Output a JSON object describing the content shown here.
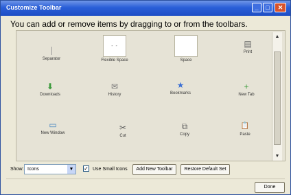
{
  "window": {
    "title": "Customize Toolbar",
    "heading": "You can add or remove items by dragging to or from the toolbars."
  },
  "palette": {
    "items": [
      {
        "label": "Separator",
        "icon": "separator-icon"
      },
      {
        "label": "Flexible Space",
        "icon": "flexible-space-icon",
        "glyph": "- -"
      },
      {
        "label": "Space",
        "icon": "space-icon"
      },
      {
        "label": "Print",
        "icon": "print-icon",
        "glyph": "▤"
      },
      {
        "label": "Downloads",
        "icon": "downloads-icon",
        "glyph": "⬇"
      },
      {
        "label": "History",
        "icon": "history-icon",
        "glyph": "✉"
      },
      {
        "label": "Bookmarks",
        "icon": "bookmarks-icon",
        "glyph": "★"
      },
      {
        "label": "New Tab",
        "icon": "new-tab-icon",
        "glyph": "+"
      },
      {
        "label": "New Window",
        "icon": "new-window-icon",
        "glyph": "▭"
      },
      {
        "label": "Cut",
        "icon": "cut-icon",
        "glyph": "✂"
      },
      {
        "label": "Copy",
        "icon": "copy-icon",
        "glyph": "⧉"
      },
      {
        "label": "Paste",
        "icon": "paste-icon",
        "glyph": "📋"
      }
    ]
  },
  "controls": {
    "show_label": "Show:",
    "show_value": "Icons",
    "use_small_icons_label": "Use Small Icons",
    "use_small_icons_checked": true,
    "add_toolbar_label": "Add New Toolbar",
    "restore_label": "Restore Default Set",
    "done_label": "Done"
  }
}
